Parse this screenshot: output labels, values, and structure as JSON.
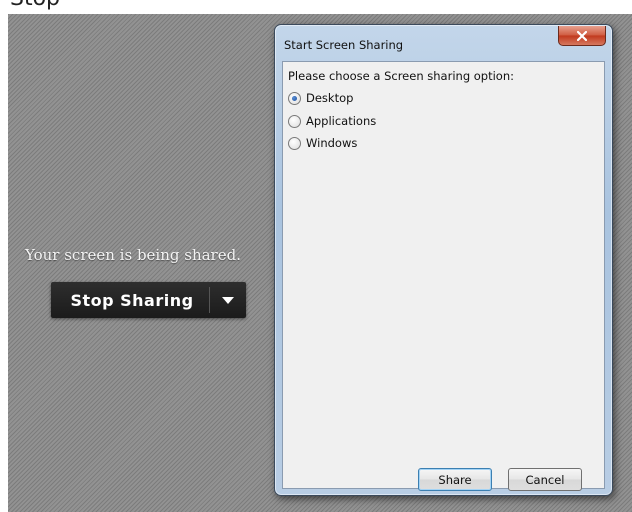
{
  "top_strip_text": "Stop",
  "share_panel": {
    "status": "Your screen is being shared.",
    "stop_button_label": "Stop Sharing",
    "dropdown_icon": "caret-down-icon"
  },
  "dialog": {
    "title": "Start Screen Sharing",
    "close_icon": "close-icon",
    "prompt": "Please choose a Screen sharing option:",
    "options": [
      {
        "label": "Desktop",
        "selected": true
      },
      {
        "label": "Applications",
        "selected": false
      },
      {
        "label": "Windows",
        "selected": false
      }
    ],
    "share_label": "Share",
    "cancel_label": "Cancel"
  },
  "colors": {
    "close_button": "#c7452b",
    "background": "#8a8a8a",
    "button_dark": "#1f1f1f"
  }
}
